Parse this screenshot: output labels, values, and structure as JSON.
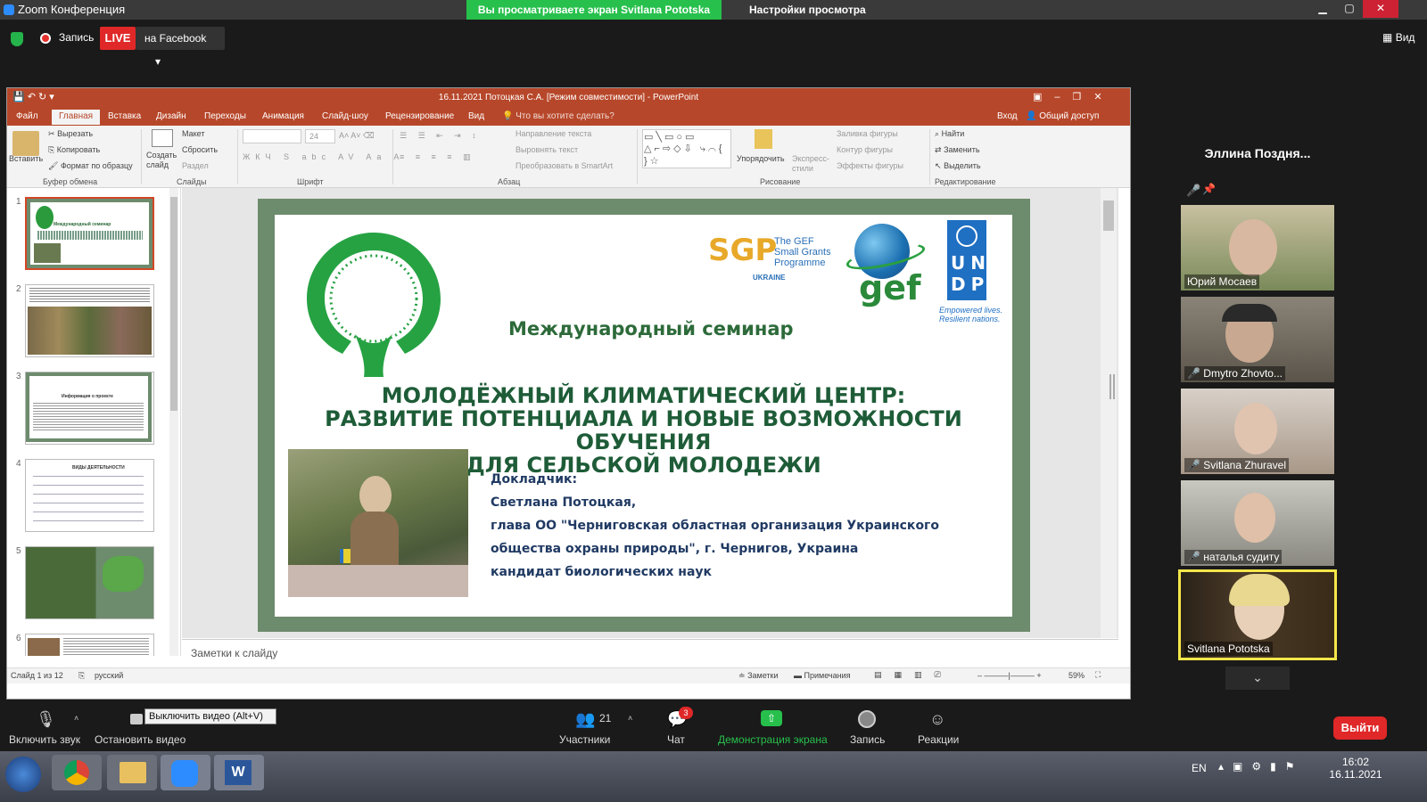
{
  "zoom": {
    "window_title": "Zoom Конференция",
    "share_banner": "Вы просматриваете экран Svitlana Pototska",
    "view_options": "Настройки просмотра",
    "record_label": "Запись",
    "live_badge": "LIVE",
    "facebook_label": "на Facebook",
    "view_label": "Вид",
    "colors": {
      "share_green": "#27c04c",
      "live_red": "#e02828",
      "speaker_border": "#f4e64a"
    }
  },
  "ppt": {
    "title": "16.11.2021 Потоцкая С.А. [Режим совместимости] - PowerPoint",
    "tabs": [
      "Файл",
      "Главная",
      "Вставка",
      "Дизайн",
      "Переходы",
      "Анимация",
      "Слайд-шоу",
      "Рецензирование",
      "Вид"
    ],
    "tell_me": "Что вы хотите сделать?",
    "login": "Вход",
    "share": "Общий доступ",
    "ribbon": {
      "paste": "Вставить",
      "cut": "Вырезать",
      "copy": "Копировать",
      "format_painter": "Формат по образцу",
      "clipboard_group": "Буфер обмена",
      "new_slide": "Создать слайд",
      "layout": "Макет",
      "reset": "Сбросить",
      "section": "Раздел",
      "slides_group": "Слайды",
      "font_size": "24",
      "font_group": "Шрифт",
      "text_direction": "Направление текста",
      "align_text": "Выровнять текст",
      "smartart": "Преобразовать в SmartArt",
      "paragraph_group": "Абзац",
      "arrange": "Упорядочить",
      "quick_styles": "Экспресс-стили",
      "shape_fill": "Заливка фигуры",
      "shape_outline": "Контур фигуры",
      "shape_effects": "Эффекты фигуры",
      "drawing_group": "Рисование",
      "find": "Найти",
      "replace": "Заменить",
      "select": "Выделить",
      "editing_group": "Редактирование"
    },
    "slide_numbers": [
      "1",
      "2",
      "3",
      "4",
      "5",
      "6"
    ],
    "notes_placeholder": "Заметки к слайду",
    "status": {
      "slide_of": "Слайд 1 из 12",
      "lang": "русский",
      "notes": "Заметки",
      "comments": "Примечания",
      "zoom": "59%"
    }
  },
  "slide": {
    "sgp_title": "SGP",
    "sgp_sub1": "The GEF",
    "sgp_sub2": "Small Grants",
    "sgp_sub3": "Programme",
    "sgp_country": "UKRAINE",
    "gef": "gef",
    "undp_letters": [
      "U",
      "N",
      "D",
      "P"
    ],
    "undp_tagline1": "Empowered lives.",
    "undp_tagline2": "Resilient nations.",
    "seminar": "Международный семинар",
    "headline1": "МОЛОДЁЖНЫЙ КЛИМАТИЧЕСКИЙ ЦЕНТР:",
    "headline2": "РАЗВИТИЕ ПОТЕНЦИАЛА И НОВЫЕ ВОЗМОЖНОСТИ ОБУЧЕНИЯ",
    "headline3": "ДЛЯ СЕЛЬСКОЙ МОЛОДЕЖИ",
    "speaker_label": "Докладчик:",
    "speaker_name": "Светлана Потоцкая,",
    "speaker_line1": "глава ОО \"Черниговская областная организация Украинского",
    "speaker_line2": "общества охраны природы\", г. Чернигов, Украина",
    "speaker_line3": "кандидат биологических наук"
  },
  "thumbs": {
    "s1_title": "Международный семинар",
    "s3_title": "Информация о проекте",
    "s4_title": "ВИДЫ ДЕЯТЕЛЬНОСТИ"
  },
  "participants": {
    "header_name": "Эллина  Поздня...",
    "tiles": [
      {
        "name": "Юрий Мосаев"
      },
      {
        "name": "Dmytro Zhovto..."
      },
      {
        "name": "Svitlana Zhuravel"
      },
      {
        "name": "наталья судиту"
      },
      {
        "name": "Svitlana Pototska"
      }
    ]
  },
  "toolbar": {
    "mute": "Включить звук",
    "stop_video": "Остановить видео",
    "tooltip": "Выключить видео (Alt+V)",
    "participants": "Участники",
    "participants_count": "21",
    "chat": "Чат",
    "chat_badge": "3",
    "share": "Демонстрация экрана",
    "record": "Запись",
    "reactions": "Реакции",
    "leave": "Выйти"
  },
  "taskbar": {
    "lang": "EN",
    "time": "16:02",
    "date": "16.11.2021"
  }
}
